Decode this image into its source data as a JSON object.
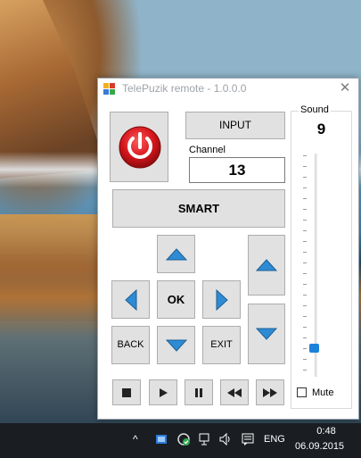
{
  "window": {
    "title": "TelePuzik remote - 1.0.0.0",
    "close_symbol": "✕"
  },
  "controls": {
    "input_label": "INPUT",
    "channel_label": "Channel",
    "channel_value": "13",
    "smart_label": "SMART",
    "ok_label": "OK",
    "back_label": "BACK",
    "exit_label": "EXIT"
  },
  "sound": {
    "label": "Sound",
    "value": "9",
    "mute_label": "Mute",
    "mute_checked": false
  },
  "icons": {
    "power": "power-icon",
    "up": "triangle-up-icon",
    "down": "triangle-down-icon",
    "left": "triangle-left-icon",
    "right": "triangle-right-icon",
    "stop": "stop-icon",
    "play": "play-icon",
    "pause": "pause-icon",
    "rewind": "rewind-icon",
    "fast_forward": "fast-forward-icon"
  },
  "colors": {
    "power_red": "#d4151c",
    "arrow_blue": "#2e8bd4",
    "slider_blue": "#1a82d9"
  },
  "taskbar": {
    "chevron": "^",
    "language": "ENG",
    "time": "0:48",
    "date": "06.09.2015"
  }
}
